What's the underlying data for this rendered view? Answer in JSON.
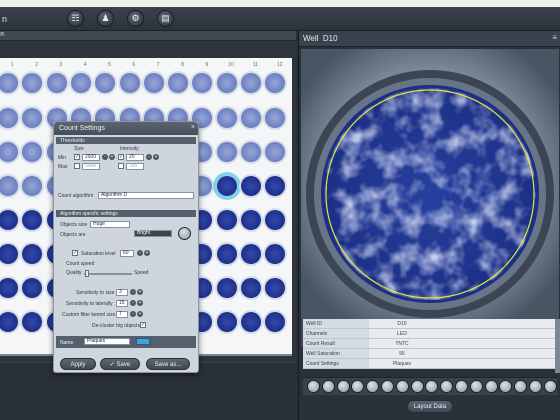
{
  "app": {
    "title_fragment": "n"
  },
  "toolbar": {
    "icons": [
      "layers-icon",
      "users-icon",
      "gear-icon",
      "book-icon"
    ]
  },
  "plate": {
    "header_label": "...",
    "columns": [
      "1",
      "2",
      "3",
      "4",
      "5",
      "6",
      "7",
      "8",
      "9",
      "10",
      "11",
      "12"
    ],
    "selected_well": "D10"
  },
  "count_settings": {
    "title": "Count Settings",
    "thresholds_section": "Thresholds",
    "min_label": "Min",
    "max_label": "Max",
    "size_label": "Size",
    "intensity_label": "Intensity",
    "size_min": "2500",
    "size_max": "5000",
    "intensity_min": "20",
    "intensity_max": "255",
    "count_algorithm_label": "Count algorithm",
    "count_algorithm_value": "Algorithm D",
    "algorithm_section": "Algorithm specific settings",
    "objects_size_label": "Objects size",
    "objects_size_value": "Huge",
    "objects_are_label": "Objects are",
    "objects_are_value": "Bright",
    "saturation_level_label": "Saturation level",
    "saturation_level_value": "60",
    "count_speed_label": "Count speed",
    "quality_label": "Quality",
    "speed_label": "Speed",
    "sens_size_label": "Sensitivity to size",
    "sens_size_value": "3",
    "sens_lat_label": "Sensitivity to laterally",
    "sens_lat_value": "15",
    "kernel_label": "Custom filter kernel size",
    "kernel_value": "7",
    "decluster_label": "De-cluster big objects",
    "name_label": "Name",
    "name_value": "Plaques",
    "apply_label": "Apply",
    "save_label": "Save",
    "save_as_label": "Save as..."
  },
  "well_view": {
    "header_label": "Well",
    "well_id": "D10",
    "info": [
      {
        "key": "Well ID",
        "value": "D10"
      },
      {
        "key": "Channels",
        "value": "LED"
      },
      {
        "key": "Count Result",
        "value": "TNTC"
      },
      {
        "key": "Well Saturation",
        "value": "56"
      },
      {
        "key": "Count Settings",
        "value": "Plaques"
      }
    ],
    "layout_data_label": "Layout Data",
    "icon_count": 17
  },
  "colors": {
    "accent": "#7fd4e8",
    "ring": "#e3e63a",
    "plaque_dark": "#1e2f8d",
    "plaque_light": "#6b7fc1"
  }
}
